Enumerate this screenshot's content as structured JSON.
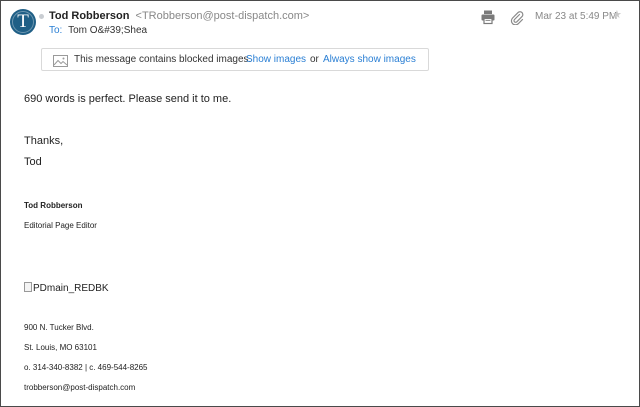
{
  "message": {
    "sender_name": "Tod Robberson",
    "sender_email": "<TRobberson@post-dispatch.com>",
    "avatar_letter": "T",
    "to_label": "To:",
    "to_name": "Tom O&#39;Shea",
    "date": "Mar 23 at 5:49 PM"
  },
  "icons": {
    "print": "printer-icon",
    "attachment": "paperclip-icon",
    "star": "star-icon",
    "image": "image-icon"
  },
  "blocked": {
    "text": "This message contains blocked images.",
    "show_images": "Show images",
    "or": "or",
    "always_show": "Always show images"
  },
  "body": {
    "line1": "690 words is perfect. Please send it to me.",
    "thanks": "Thanks,",
    "name": "Tod"
  },
  "signature": {
    "name": "Tod Robberson",
    "title": "Editorial Page Editor",
    "image_alt": "PDmain_REDBK",
    "address1": "900 N. Tucker Blvd.",
    "address2": "St. Louis, MO 63101",
    "phones": "o. 314-340-8382 | c. 469-544-8265",
    "email": "trobberson@post-dispatch.com"
  },
  "colors": {
    "link": "#2a7fd4",
    "avatar": "#1f5f86",
    "muted": "#888888"
  }
}
